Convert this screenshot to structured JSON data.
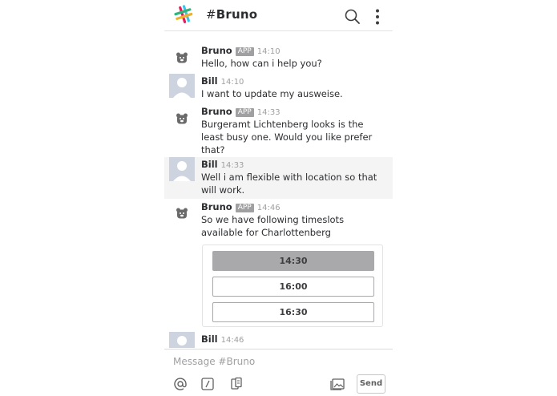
{
  "header": {
    "hash": "#",
    "channel": "Bruno",
    "search_icon": "search-icon",
    "menu_icon": "kebab-menu-icon"
  },
  "messages": [
    {
      "sender": "Bruno",
      "badge": "APP",
      "time": "14:10",
      "text": "Hello, how can i help you?",
      "avatar": "bear-icon"
    },
    {
      "sender": "Bill",
      "time": "14:10",
      "text": "I want to update my ausweise.",
      "avatar": "user-avatar"
    },
    {
      "sender": "Bruno",
      "badge": "APP",
      "time": "14:33",
      "text": "Burgeramt Lichtenberg looks is the least busy one. Would you like prefer that?",
      "avatar": "bear-icon"
    },
    {
      "sender": "Bill",
      "time": "14:33",
      "text": "Well i am flexible with location so that will work.",
      "avatar": "user-avatar"
    },
    {
      "sender": "Bruno",
      "badge": "APP",
      "time": "14:46",
      "text": "So we have following timeslots available for Charlottenberg",
      "avatar": "bear-icon"
    },
    {
      "sender": "Bill",
      "time": "14:46",
      "text": "",
      "avatar": "user-avatar"
    }
  ],
  "timeslots": [
    {
      "label": "14:30",
      "selected": true
    },
    {
      "label": "16:00",
      "selected": false
    },
    {
      "label": "16:30",
      "selected": false
    }
  ],
  "composer": {
    "placeholder": "Message #Bruno",
    "send_label": "Send",
    "icons": [
      "at-icon",
      "slash-command-icon",
      "attachment-icon",
      "gallery-icon"
    ]
  },
  "colors": {
    "muted": "#a0a0a2",
    "selected_slot": "#a9a9ab",
    "highlight_row": "#f4f4f4"
  }
}
